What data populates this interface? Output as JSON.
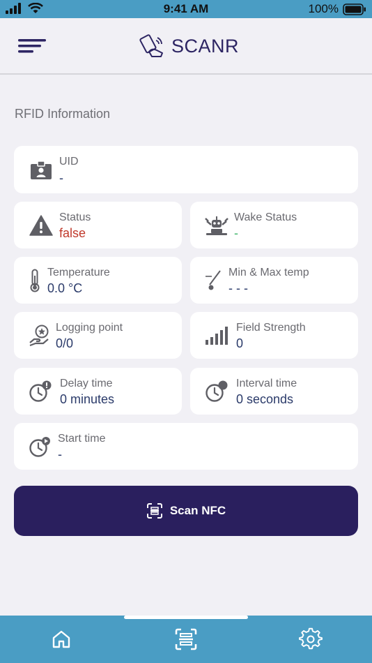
{
  "status_bar": {
    "time": "9:41 AM",
    "battery": "100%"
  },
  "header": {
    "app_name": "SCANR",
    "icons": [
      "hamburger-menu-icon",
      "scanr-logo-icon"
    ]
  },
  "section_title": "RFID Information",
  "cards": {
    "uid": {
      "label": "UID",
      "value": "-"
    },
    "status": {
      "label": "Status",
      "value": "false"
    },
    "wake_status": {
      "label": "Wake Status",
      "value": "-"
    },
    "temperature": {
      "label": "Temperature",
      "value": "0.0 °C"
    },
    "min_max_temp": {
      "label": "Min & Max temp",
      "value": "- - -"
    },
    "logging_point": {
      "label": "Logging point",
      "value": "0/0"
    },
    "field_strength": {
      "label": "Field Strength",
      "value": "0"
    },
    "delay_time": {
      "label": "Delay time",
      "value": "0 minutes"
    },
    "interval_time": {
      "label": "Interval time",
      "value": "0 seconds"
    },
    "start_time": {
      "label": "Start time",
      "value": "-"
    }
  },
  "scan_button": {
    "label": "Scan NFC"
  },
  "tab_bar": {
    "tabs": [
      "home-icon",
      "scan-icon",
      "settings-icon"
    ]
  },
  "colors": {
    "primary": "#2a1f5e",
    "bars": "#4a9dc4",
    "status_false": "#c0392b",
    "wake_status": "#3fb56b",
    "value_text": "#2b3b6a"
  }
}
